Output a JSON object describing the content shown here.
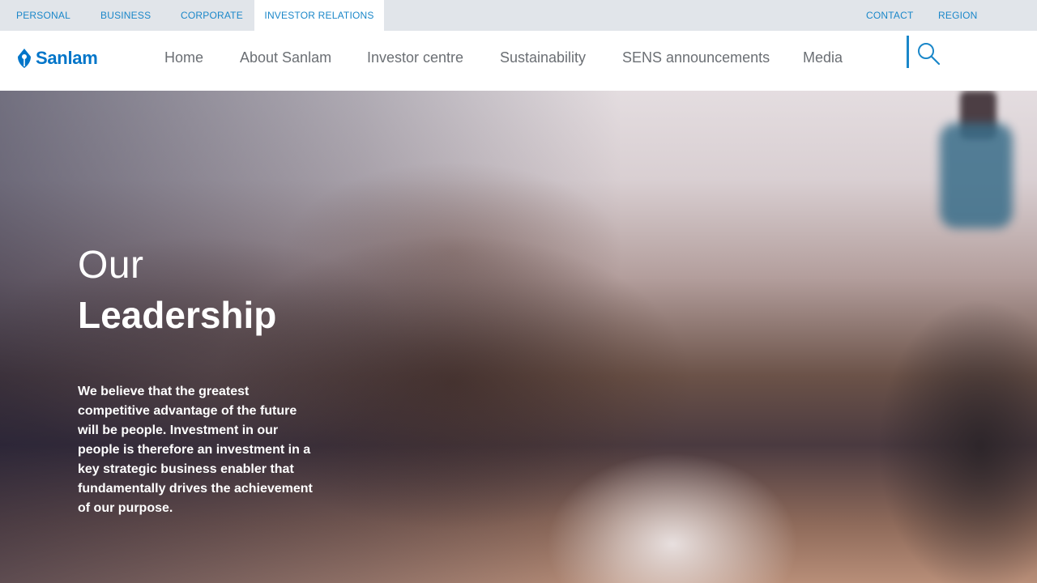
{
  "topbar": {
    "tabs": [
      {
        "label": "PERSONAL"
      },
      {
        "label": "BUSINESS"
      },
      {
        "label": "CORPORATE"
      },
      {
        "label": "INVESTOR RELATIONS",
        "active": true
      }
    ],
    "contact_label": "CONTACT",
    "region_label": "REGION"
  },
  "header": {
    "logo_text": "Sanlam",
    "nav": [
      {
        "label": "Home"
      },
      {
        "label": "About Sanlam"
      },
      {
        "label": "Investor centre"
      },
      {
        "label": "Sustainability"
      },
      {
        "label": "SENS announcements"
      },
      {
        "label": "Media"
      }
    ],
    "search_icon": "search-icon"
  },
  "hero": {
    "title_light": "Our",
    "title_bold": "Leadership",
    "body": "We believe that the greatest competitive advantage of the future will be people. Investment in our people is therefore an investment in a key strategic business enabler that fundamentally drives the achievement of our purpose."
  },
  "colors": {
    "brand_blue": "#0075c9",
    "link_blue": "#1a87c9",
    "topbar_bg": "#e1e5ea",
    "nav_text": "#6b6f74"
  }
}
